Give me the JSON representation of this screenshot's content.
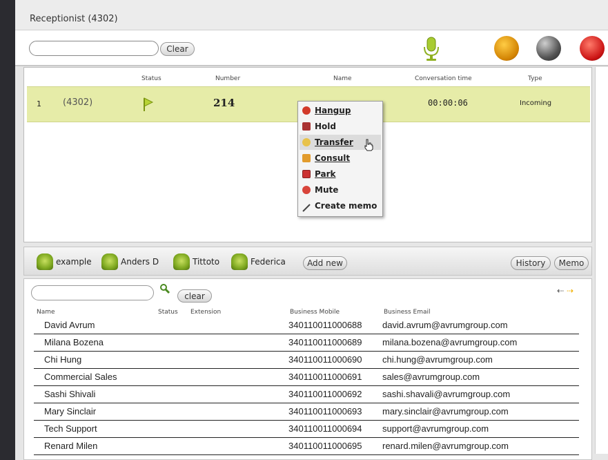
{
  "window": {
    "title": "Receptionist (4302)"
  },
  "toolbar": {
    "clear_label": "Clear",
    "icons": [
      "microphone-icon",
      "consult-icon",
      "hold-icon",
      "hangup-icon"
    ]
  },
  "calls": {
    "headers": {
      "status": "Status",
      "number": "Number",
      "name": "Name",
      "conversation_time": "Conversation time",
      "type": "Type"
    },
    "rows": [
      {
        "index": "1",
        "extension": "(4302)",
        "number": "214",
        "conversation_time": "00:00:06",
        "type": "Incoming"
      }
    ]
  },
  "context_menu": {
    "items": [
      {
        "label": "Hangup",
        "icon": "hangup-icon"
      },
      {
        "label": "Hold",
        "icon": "hold-icon"
      },
      {
        "label": "Transfer",
        "icon": "transfer-icon"
      },
      {
        "label": "Consult",
        "icon": "consult-icon"
      },
      {
        "label": "Park",
        "icon": "park-icon"
      },
      {
        "label": "Mute",
        "icon": "mute-icon"
      },
      {
        "label": "Create memo",
        "icon": "memo-icon"
      }
    ]
  },
  "speed_dial": {
    "items": [
      "example",
      "Anders D",
      "Tittoto",
      "Federica"
    ],
    "add_new": "Add new",
    "history": "History",
    "memo": "Memo"
  },
  "contacts": {
    "clear_label": "clear",
    "headers": {
      "name": "Name",
      "status": "Status",
      "extension": "Extension",
      "mobile": "Business Mobile",
      "email": "Business Email"
    },
    "rows": [
      {
        "name": "David Avrum",
        "mobile": "340110011000688",
        "email": "david.avrum@avrumgroup.com"
      },
      {
        "name": "Milana Bozena",
        "mobile": "340110011000689",
        "email": "milana.bozena@avrumgroup.com"
      },
      {
        "name": "Chi Hung",
        "mobile": "340110011000690",
        "email": "chi.hung@avrumgroup.com"
      },
      {
        "name": "Commercial Sales",
        "mobile": "340110011000691",
        "email": "sales@avrumgroup.com"
      },
      {
        "name": "Sashi Shivali",
        "mobile": "340110011000692",
        "email": "sashi.shavali@avrumgroup.com"
      },
      {
        "name": "Mary Sinclair",
        "mobile": "340110011000693",
        "email": "mary.sinclair@avrumgroup.com"
      },
      {
        "name": "Tech Support",
        "mobile": "340110011000694",
        "email": "support@avrumgroup.com"
      },
      {
        "name": "Renard Milen",
        "mobile": "340110011000695",
        "email": "renard.milen@avrumgroup.com"
      }
    ]
  }
}
